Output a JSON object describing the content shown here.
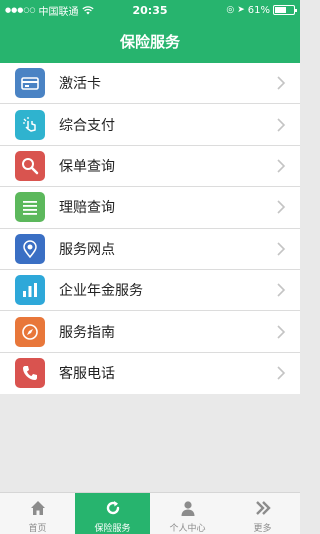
{
  "status_bar": {
    "carrier": "中国联通",
    "time": "20:35",
    "battery": "61%",
    "battery_level": 0.61
  },
  "header": {
    "title": "保险服务"
  },
  "menu": {
    "items": [
      {
        "label": "激活卡",
        "icon": "card-icon",
        "color": "#4a83c4"
      },
      {
        "label": "综合支付",
        "icon": "tap-icon",
        "color": "#2fb3cf"
      },
      {
        "label": "保单查询",
        "icon": "magnifier-icon",
        "color": "#d9544f"
      },
      {
        "label": "理赔查询",
        "icon": "list-icon",
        "color": "#5cb85c"
      },
      {
        "label": "服务网点",
        "icon": "location-pin-icon",
        "color": "#3a6fc4"
      },
      {
        "label": "企业年金服务",
        "icon": "bar-chart-icon",
        "color": "#2ea8d9"
      },
      {
        "label": "服务指南",
        "icon": "compass-icon",
        "color": "#e8773a"
      },
      {
        "label": "客服电话",
        "icon": "phone-icon",
        "color": "#d9534f"
      }
    ]
  },
  "tab_bar": {
    "tabs": [
      {
        "label": "首页",
        "icon": "home-icon"
      },
      {
        "label": "保险服务",
        "icon": "refresh-icon",
        "active": true
      },
      {
        "label": "个人中心",
        "icon": "person-icon"
      },
      {
        "label": "更多",
        "icon": "double-chevron-icon"
      }
    ]
  }
}
